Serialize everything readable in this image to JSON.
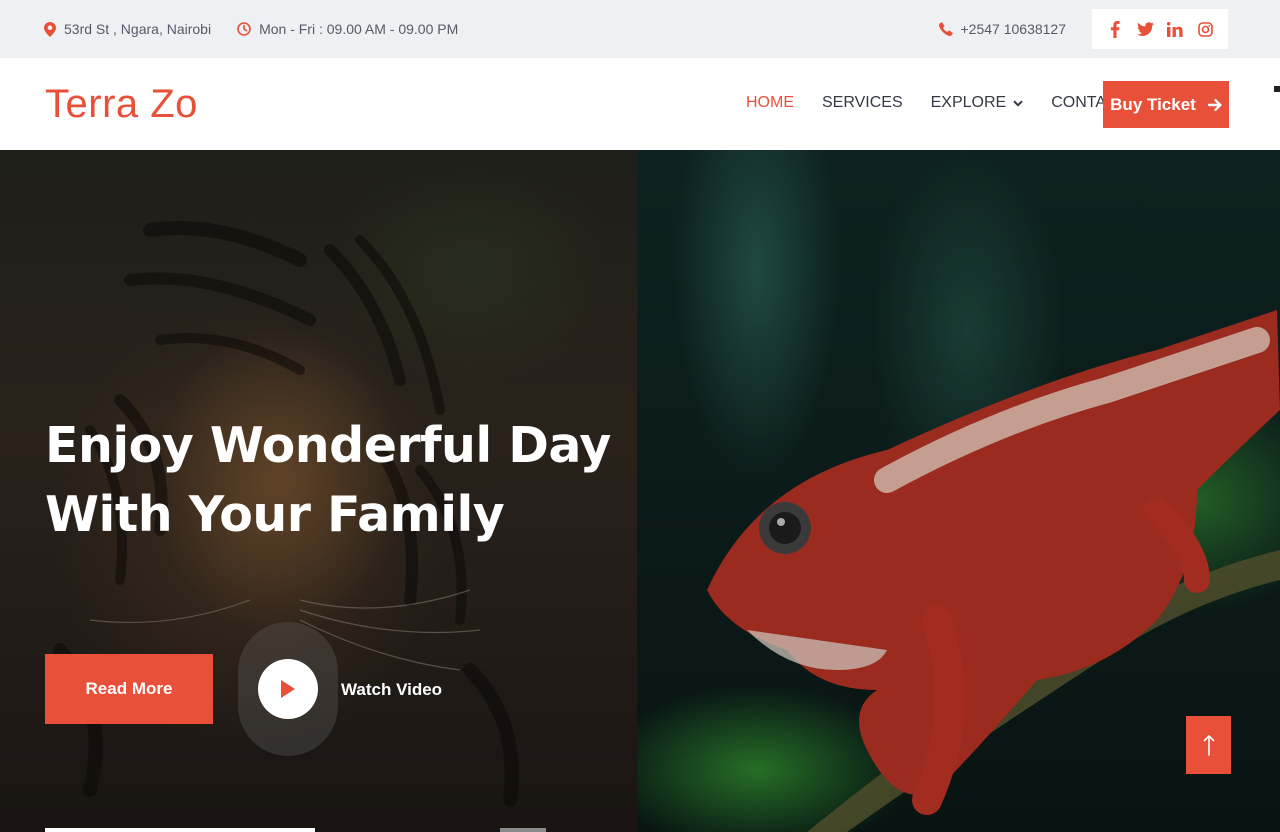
{
  "topbar": {
    "address": "53rd St , Ngara, Nairobi",
    "hours": "Mon - Fri : 09.00 AM - 09.00 PM",
    "phone": "+2547 10638127",
    "social": [
      {
        "icon": "facebook-icon",
        "glyph": "f"
      },
      {
        "icon": "twitter-icon",
        "glyph": "t"
      },
      {
        "icon": "linkedin-icon",
        "glyph": "in"
      },
      {
        "icon": "instagram-icon",
        "glyph": "ig"
      }
    ]
  },
  "header": {
    "logo": "Terra Zo",
    "nav": [
      {
        "label": "HOME",
        "active": true
      },
      {
        "label": "SERVICES",
        "active": false
      },
      {
        "label": "EXPLORE",
        "active": false,
        "dropdown": true
      },
      {
        "label": "CONTACT",
        "active": false
      }
    ],
    "cta_label": "Buy Ticket"
  },
  "hero": {
    "title_line1": "Enjoy Wonderful Day",
    "title_line2": "With Your Family",
    "read_more_label": "Read More",
    "watch_video_label": "Watch Video"
  },
  "colors": {
    "accent": "#e8503a",
    "topbar_bg": "#eef0f4",
    "text_dark": "#333a45",
    "text_muted": "#555a66"
  }
}
